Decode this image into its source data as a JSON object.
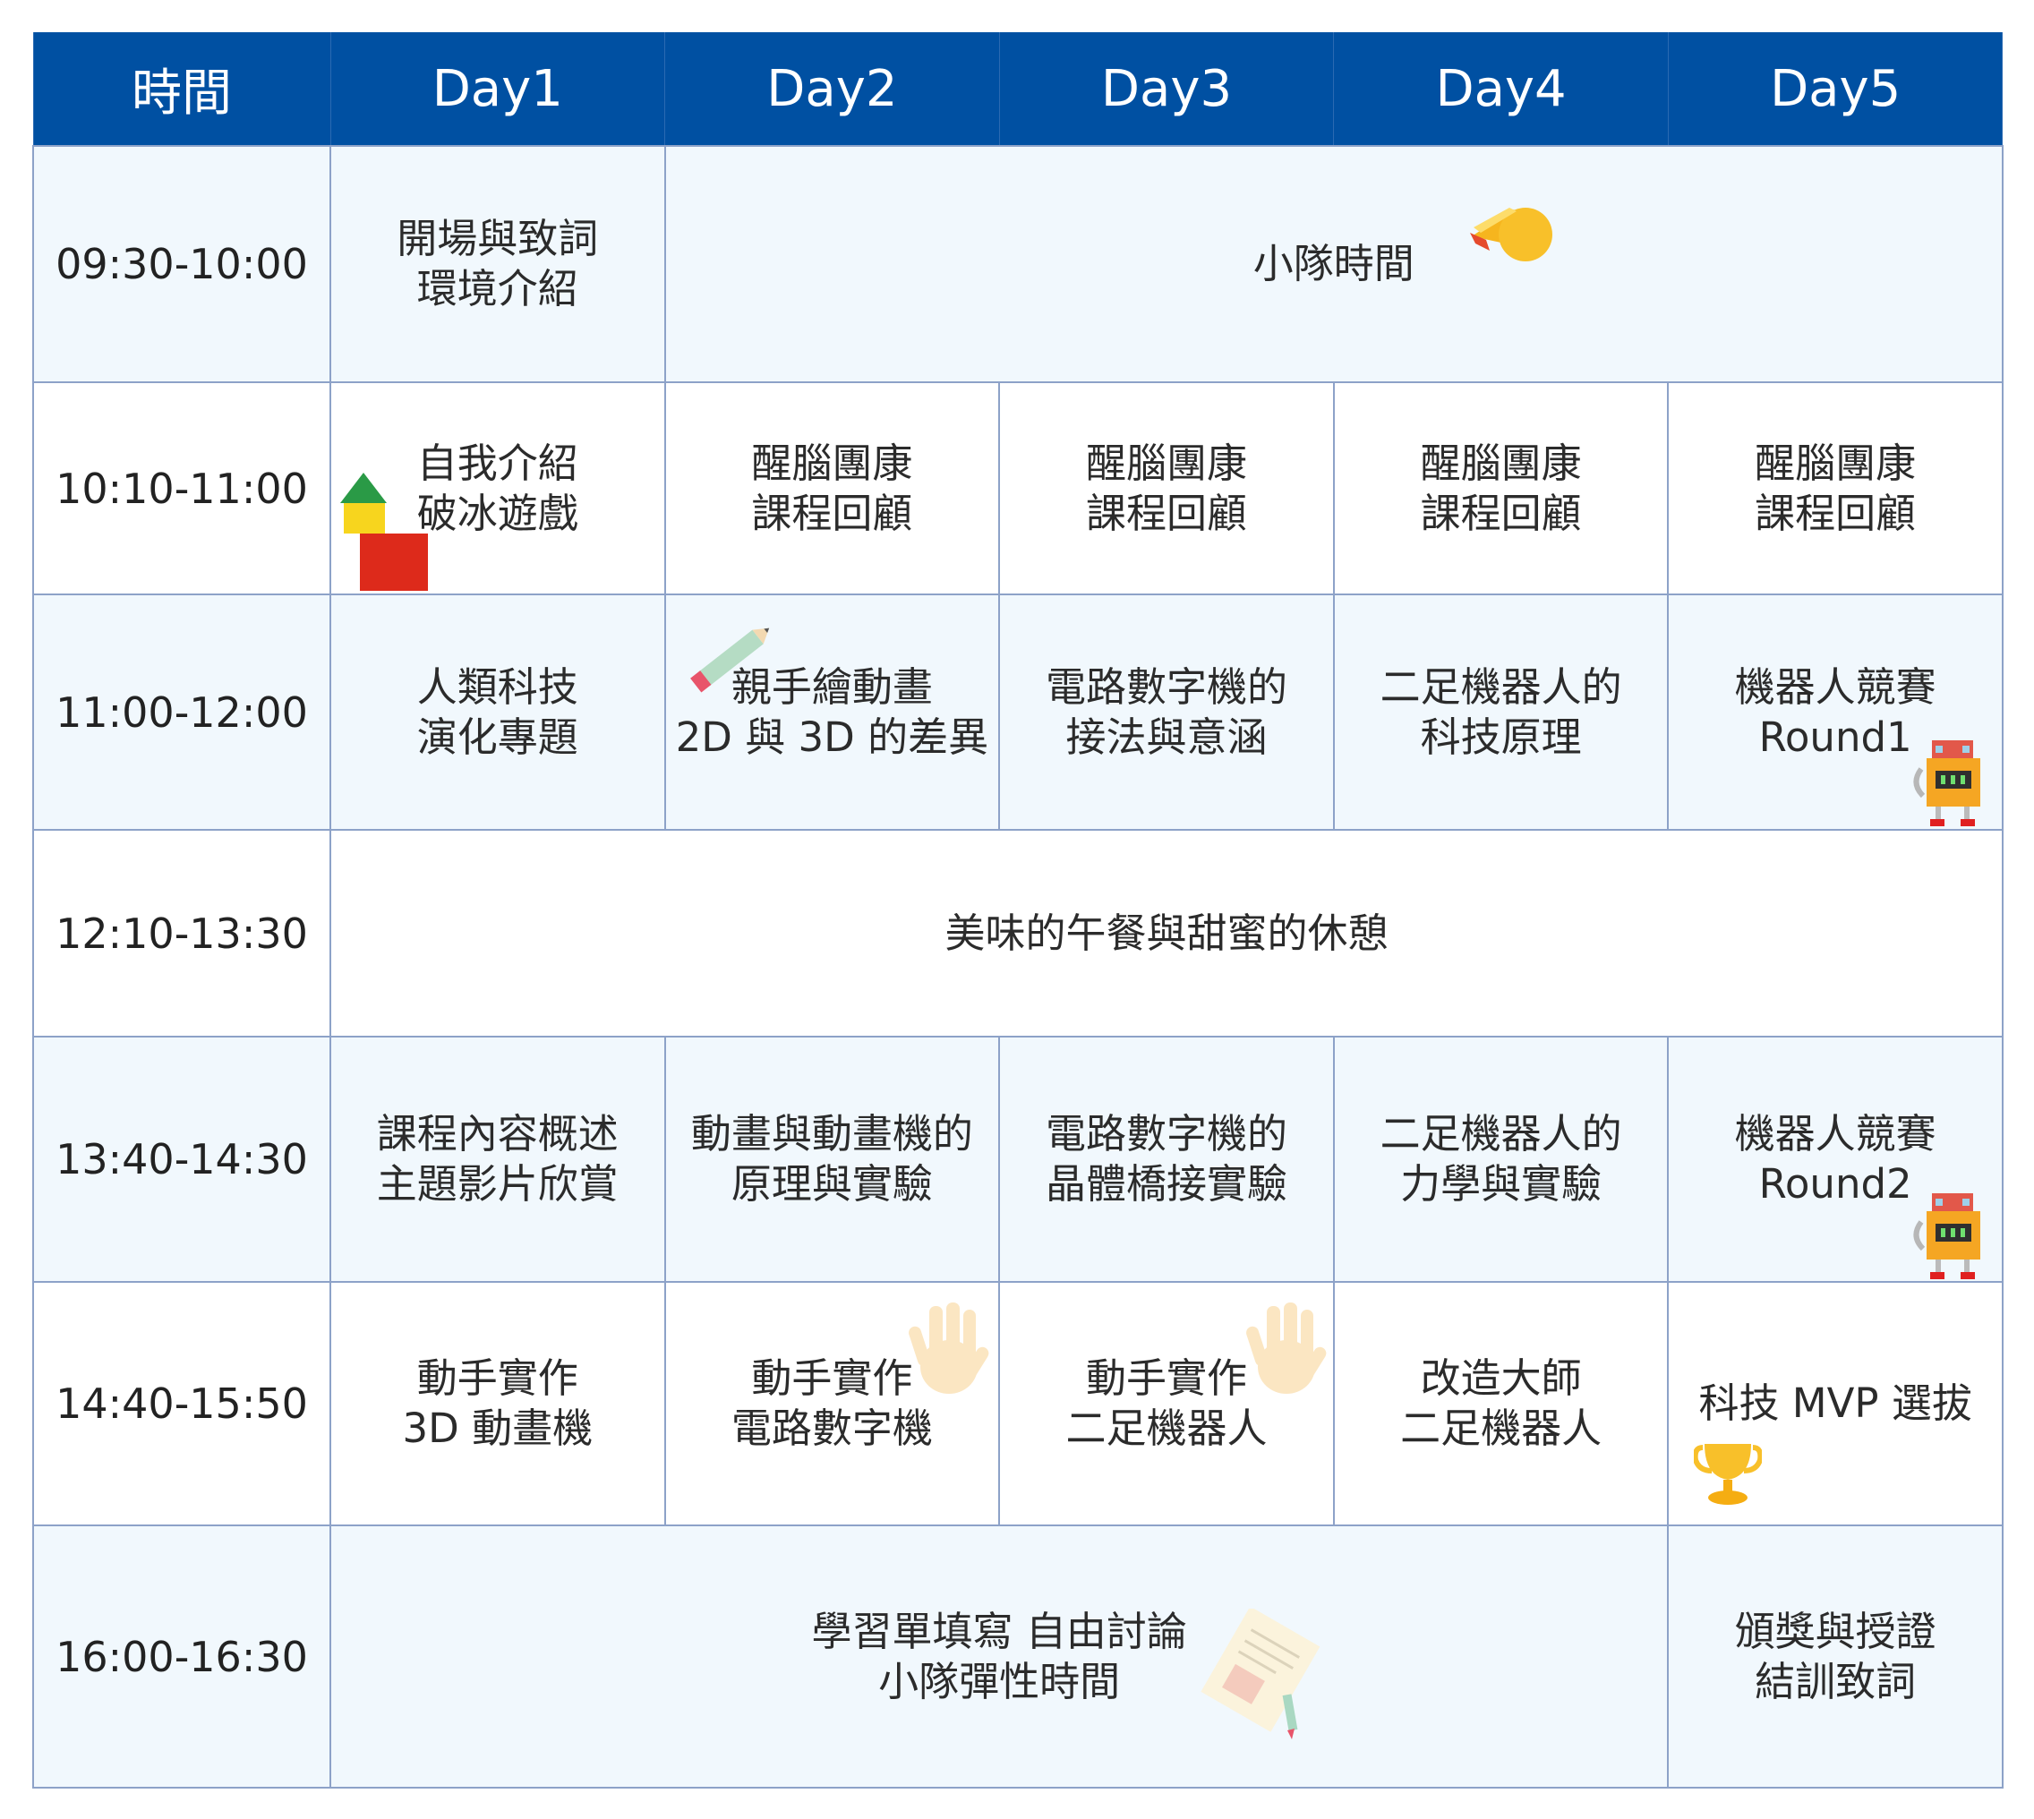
{
  "header": {
    "columns": [
      "時間",
      "Day1",
      "Day2",
      "Day3",
      "Day4",
      "Day5"
    ]
  },
  "rows": [
    {
      "time": "09:30-10:00",
      "cells": [
        {
          "lines": [
            "開場與致詞",
            "環境介紹"
          ]
        },
        {
          "lines": [
            "小隊時間"
          ],
          "span": 4
        }
      ]
    },
    {
      "time": "10:10-11:00",
      "cells": [
        {
          "lines": [
            "自我介紹",
            "破冰遊戲"
          ]
        },
        {
          "lines": [
            "醒腦團康",
            "課程回顧"
          ]
        },
        {
          "lines": [
            "醒腦團康",
            "課程回顧"
          ]
        },
        {
          "lines": [
            "醒腦團康",
            "課程回顧"
          ]
        },
        {
          "lines": [
            "醒腦團康",
            "課程回顧"
          ]
        }
      ]
    },
    {
      "time": "11:00-12:00",
      "cells": [
        {
          "lines": [
            "人類科技",
            "演化專題"
          ]
        },
        {
          "lines": [
            "親手繪動畫",
            "2D 與 3D 的差異"
          ]
        },
        {
          "lines": [
            "電路數字機的",
            "接法與意涵"
          ]
        },
        {
          "lines": [
            "二足機器人的",
            "科技原理"
          ]
        },
        {
          "lines": [
            "機器人競賽",
            "Round1"
          ]
        }
      ]
    },
    {
      "time": "12:10-13:30",
      "cells": [
        {
          "lines": [
            "美味的午餐與甜蜜的休憩"
          ],
          "span": 5
        }
      ]
    },
    {
      "time": "13:40-14:30",
      "cells": [
        {
          "lines": [
            "課程內容概述",
            "主題影片欣賞"
          ]
        },
        {
          "lines": [
            "動畫與動畫機的",
            "原理與實驗"
          ]
        },
        {
          "lines": [
            "電路數字機的",
            "晶體橋接實驗"
          ]
        },
        {
          "lines": [
            "二足機器人的",
            "力學與實驗"
          ]
        },
        {
          "lines": [
            "機器人競賽",
            "Round2"
          ]
        }
      ]
    },
    {
      "time": "14:40-15:50",
      "cells": [
        {
          "lines": [
            "動手實作",
            "3D 動畫機"
          ]
        },
        {
          "lines": [
            "動手實作",
            "電路數字機"
          ]
        },
        {
          "lines": [
            "動手實作",
            "二足機器人"
          ]
        },
        {
          "lines": [
            "改造大師",
            "二足機器人"
          ]
        },
        {
          "lines": [
            "科技 MVP 選拔"
          ]
        }
      ]
    },
    {
      "time": "16:00-16:30",
      "cells": [
        {
          "lines": [
            "學習單填寫 自由討論",
            "小隊彈性時間"
          ],
          "span": 4
        },
        {
          "lines": [
            "頒獎與授證",
            "結訓致詞"
          ]
        }
      ]
    }
  ],
  "icons": {
    "whistle": "whistle-icon",
    "blocks": "toy-blocks-icon",
    "pencil": "pencil-icon",
    "robot": "robot-icon",
    "hand": "hand-icon",
    "trophy": "trophy-icon",
    "paper": "worksheet-paper-icon"
  },
  "colors": {
    "header_bg": "#0050a2",
    "header_text": "#ffffff",
    "row_tint": "#f1f8fd",
    "grid_line": "#8da2c8"
  }
}
